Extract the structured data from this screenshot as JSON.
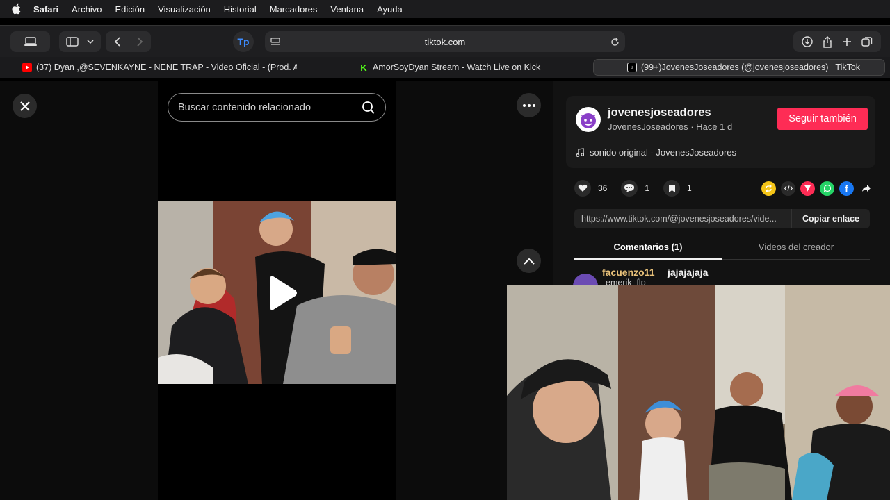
{
  "menubar": {
    "items": [
      "Safari",
      "Archivo",
      "Edición",
      "Visualización",
      "Historial",
      "Marcadores",
      "Ventana",
      "Ayuda"
    ]
  },
  "toolbar": {
    "address": "tiktok.com",
    "extension_badge": "Tp"
  },
  "tabs": [
    {
      "title": "(37) Dyan ,@SEVENKAYNE - NENE TRAP - Video Oficial - (Prod. A...",
      "favicon": "youtube-icon",
      "favicon_color": "#ff0000"
    },
    {
      "title": "AmorSoyDyan Stream - Watch Live on Kick",
      "favicon": "kick-icon",
      "favicon_color": "#53fc18"
    },
    {
      "title": "(99+)JovenesJoseadores (@jovenesjoseadores) | TikTok",
      "favicon": "tiktok-icon",
      "favicon_color": "#ffffff",
      "active": true
    }
  ],
  "search": {
    "placeholder": "Buscar contenido relacionado"
  },
  "post": {
    "username": "jovenesjoseadores",
    "subtitle": "JovenesJoseadores · Hace 1 d",
    "follow_label": "Seguir también",
    "sound": "sonido original - JovenesJoseadores",
    "likes": "36",
    "comments": "1",
    "saves": "1",
    "share_link": "https://www.tiktok.com/@jovenesjoseadores/vide...",
    "copy_label": "Copiar enlace"
  },
  "panel_tabs": {
    "comments": "Comentarios (1)",
    "creator_videos": "Videos del creador"
  },
  "comment": {
    "user": "facuenzo11",
    "text": "jajajajaja",
    "sub": "emerik_flp"
  },
  "colors": {
    "accent": "#fe2c55",
    "background": "#000000",
    "panel": "#121212"
  }
}
